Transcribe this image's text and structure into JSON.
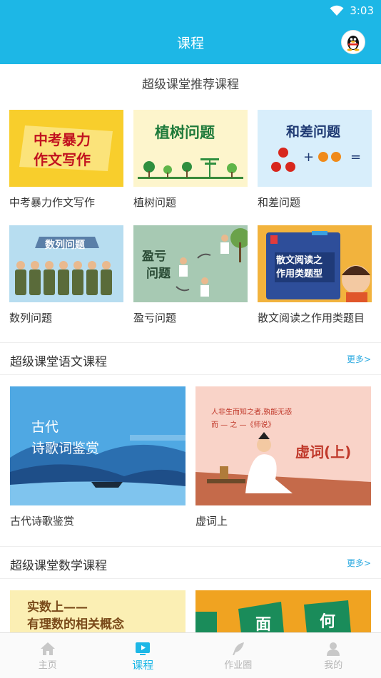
{
  "status": {
    "time": "3:03"
  },
  "header": {
    "title": "课程"
  },
  "recommended": {
    "title": "超级课堂推荐课程",
    "courses": [
      {
        "label": "中考暴力作文写作",
        "thumb_lines": [
          "中考暴力",
          "作文写作"
        ]
      },
      {
        "label": "植树问题",
        "thumb_lines": [
          "植树问题"
        ]
      },
      {
        "label": "和差问题",
        "thumb_lines": [
          "和差问题"
        ]
      },
      {
        "label": "数列问题",
        "thumb_lines": [
          "数列问题"
        ]
      },
      {
        "label": "盈亏问题",
        "thumb_lines": [
          "盈亏",
          "问题"
        ]
      },
      {
        "label": "散文阅读之作用类题目",
        "thumb_lines": [
          "散文阅读之",
          "作用类题型"
        ]
      }
    ]
  },
  "chinese": {
    "title": "超级课堂语文课程",
    "more": "更多>",
    "courses": [
      {
        "label": "古代诗歌鉴赏",
        "thumb_lines": [
          "古代",
          "诗歌词鉴赏"
        ]
      },
      {
        "label": "虚词上",
        "thumb_lines": [
          "虚词(上)",
          "人非生而知之者,孰能无惑",
          "而 — 之 —《师说》"
        ]
      }
    ]
  },
  "math": {
    "title": "超级课堂数学课程",
    "more": "更多>",
    "courses": [
      {
        "thumb_lines": [
          "实数上——",
          "有理数的相关概念"
        ]
      },
      {
        "thumb_lines": [
          "面",
          "何"
        ]
      }
    ]
  },
  "nav": {
    "items": [
      {
        "label": "主页",
        "icon": "home-icon"
      },
      {
        "label": "课程",
        "icon": "play-icon",
        "active": true
      },
      {
        "label": "作业圈",
        "icon": "feather-icon"
      },
      {
        "label": "我的",
        "icon": "person-icon"
      }
    ]
  },
  "colors": {
    "primary": "#1DB7E6",
    "more_link": "#2aa9e0",
    "inactive": "#b5b5b5"
  }
}
